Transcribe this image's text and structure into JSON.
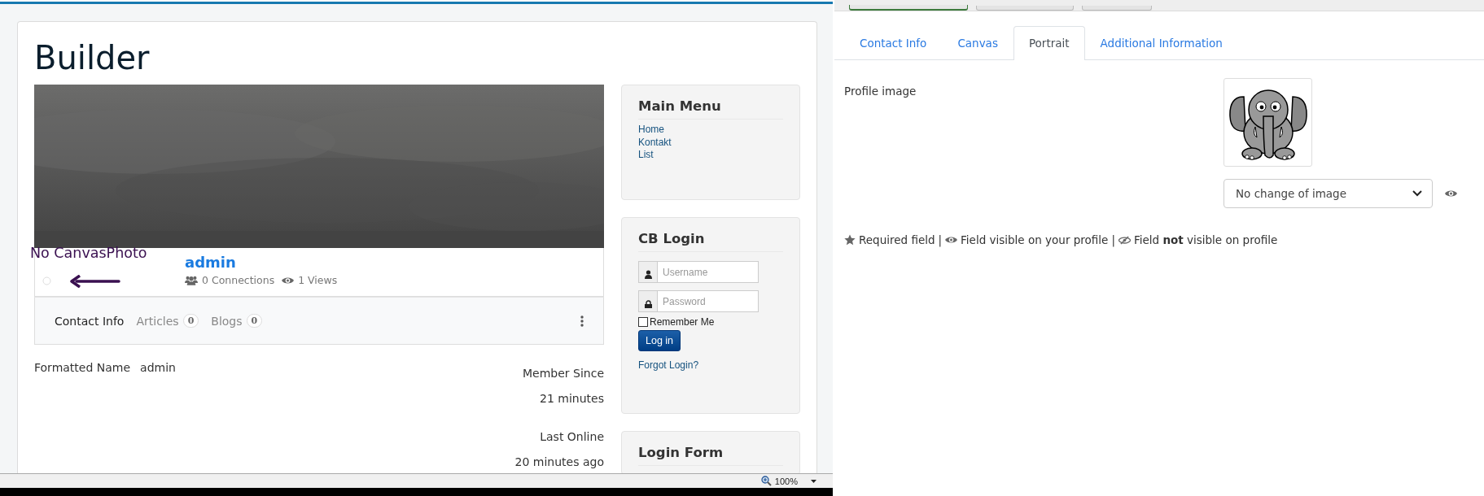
{
  "left_page": {
    "title": "Builder",
    "profile": {
      "annotation": "No CanvasPhoto",
      "name": "admin",
      "connections": "0 Connections",
      "views": "1 Views"
    },
    "tabs": [
      {
        "label": "Contact Info",
        "selected": true
      },
      {
        "label": "Articles",
        "count": "0",
        "selected": false
      },
      {
        "label": "Blogs",
        "count": "0",
        "selected": false
      }
    ],
    "fields": [
      {
        "label": "Formatted Name",
        "value": "admin"
      }
    ],
    "stats": [
      {
        "label": "Member Since",
        "value": "21 minutes"
      },
      {
        "label": "Last Online",
        "value": "20 minutes ago"
      }
    ],
    "modules": [
      {
        "kind": "menu",
        "title": "Main Menu",
        "items": [
          "Home",
          "Kontakt",
          "List"
        ]
      },
      {
        "kind": "login",
        "title": "CB Login",
        "inputs": [
          {
            "kind": "user",
            "placeholder": "Username"
          },
          {
            "kind": "lock",
            "placeholder": "Password"
          }
        ],
        "remember": {
          "label": "Remember Me",
          "checked": false
        },
        "button": "Log in",
        "link": "Forgot Login?"
      },
      {
        "kind": "plain",
        "title": "Login Form"
      }
    ],
    "status_bar": {
      "zoom": "100%"
    }
  },
  "right_page": {
    "tabs": [
      {
        "label": "Contact Info",
        "selected": false
      },
      {
        "label": "Canvas",
        "selected": false
      },
      {
        "label": "Portrait",
        "selected": true
      },
      {
        "label": "Additional Information",
        "selected": false
      }
    ],
    "field": {
      "label": "Profile image",
      "select": "No change of image"
    },
    "legend": {
      "separator": "|",
      "items": [
        {
          "kind": "required",
          "text": "Required field"
        },
        {
          "kind": "visible",
          "text": "Field visible on your profile"
        },
        {
          "kind": "hidden",
          "text": "Field **not** visible on profile"
        }
      ]
    }
  }
}
